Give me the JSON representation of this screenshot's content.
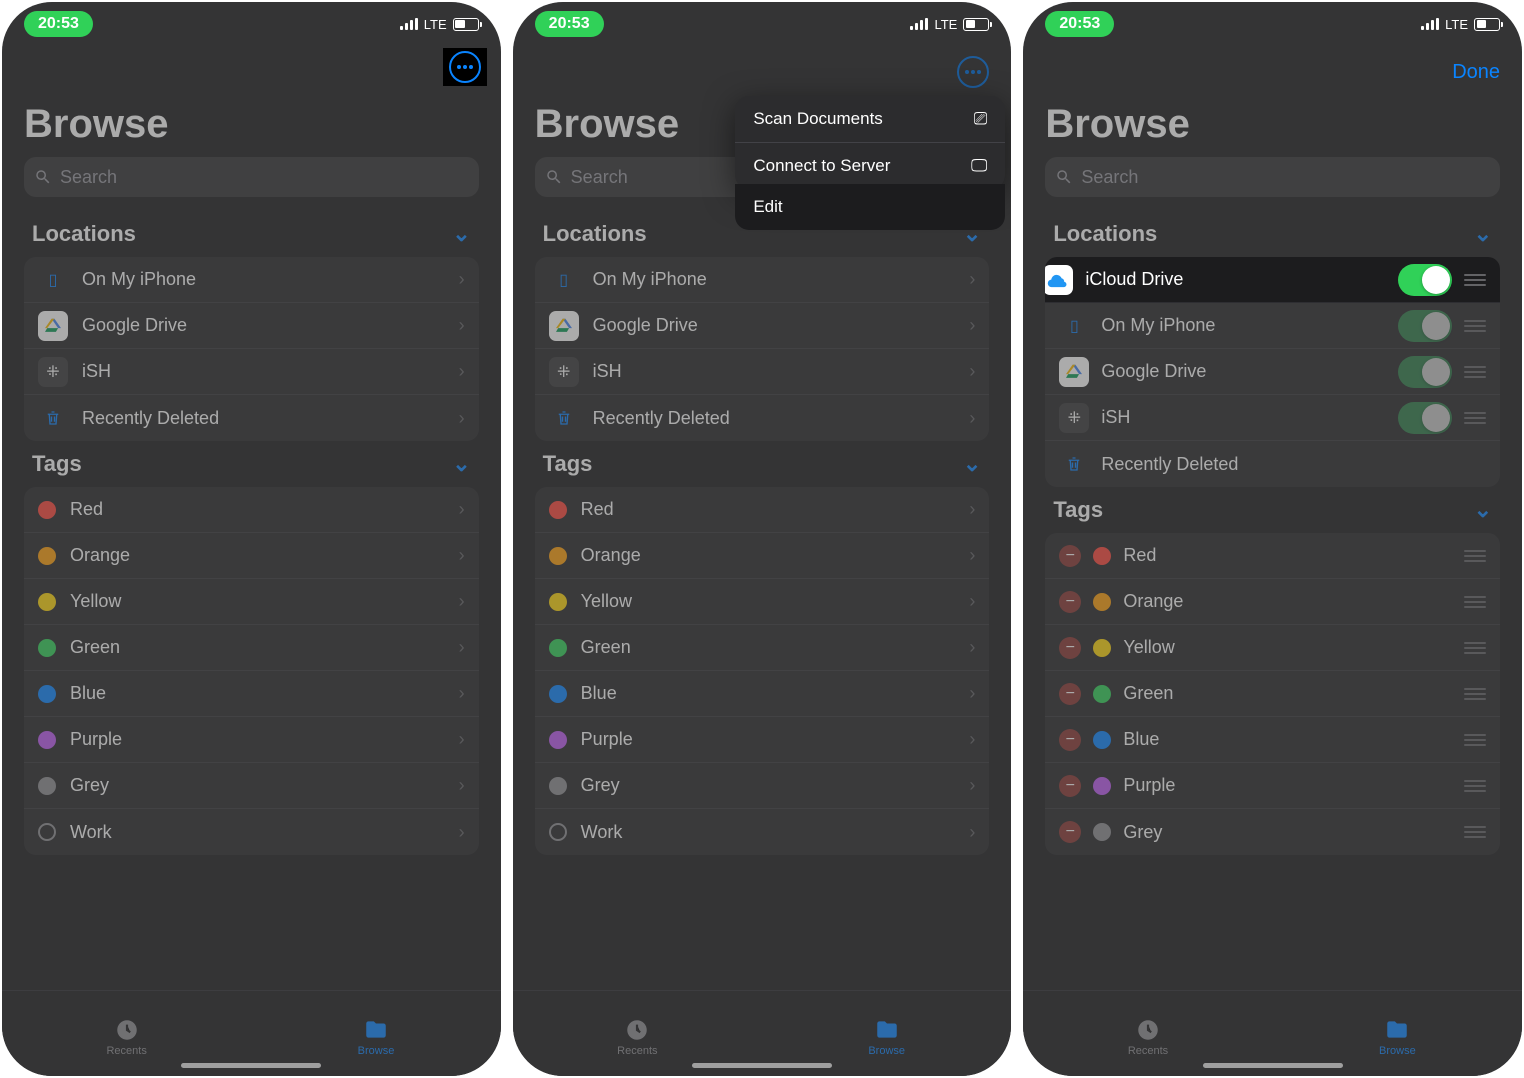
{
  "status": {
    "time": "20:53",
    "network": "LTE"
  },
  "header": {
    "title": "Browse",
    "done": "Done"
  },
  "search": {
    "placeholder": "Search"
  },
  "sections": {
    "locations": "Locations",
    "tags": "Tags"
  },
  "locations": [
    {
      "label": "On My iPhone"
    },
    {
      "label": "Google Drive"
    },
    {
      "label": "iSH"
    },
    {
      "label": "Recently Deleted"
    }
  ],
  "edit_locations": [
    {
      "label": "iCloud Drive"
    },
    {
      "label": "On My iPhone"
    },
    {
      "label": "Google Drive"
    },
    {
      "label": "iSH"
    },
    {
      "label": "Recently Deleted"
    }
  ],
  "tags": [
    {
      "label": "Red",
      "color": "#ff453a"
    },
    {
      "label": "Orange",
      "color": "#ff9f0a"
    },
    {
      "label": "Yellow",
      "color": "#ffd60a"
    },
    {
      "label": "Green",
      "color": "#30d158"
    },
    {
      "label": "Blue",
      "color": "#0a84ff"
    },
    {
      "label": "Purple",
      "color": "#bf5af2"
    },
    {
      "label": "Grey",
      "color": "#8e8e93"
    },
    {
      "label": "Work",
      "color": ""
    }
  ],
  "edit_tags": [
    {
      "label": "Red",
      "color": "#ff453a"
    },
    {
      "label": "Orange",
      "color": "#ff9f0a"
    },
    {
      "label": "Yellow",
      "color": "#ffd60a"
    },
    {
      "label": "Green",
      "color": "#30d158"
    },
    {
      "label": "Blue",
      "color": "#0a84ff"
    },
    {
      "label": "Purple",
      "color": "#bf5af2"
    },
    {
      "label": "Grey",
      "color": "#8e8e93"
    }
  ],
  "popup": {
    "scan": "Scan Documents",
    "connect": "Connect to Server",
    "edit": "Edit"
  },
  "tabs": {
    "recents": "Recents",
    "browse": "Browse"
  }
}
